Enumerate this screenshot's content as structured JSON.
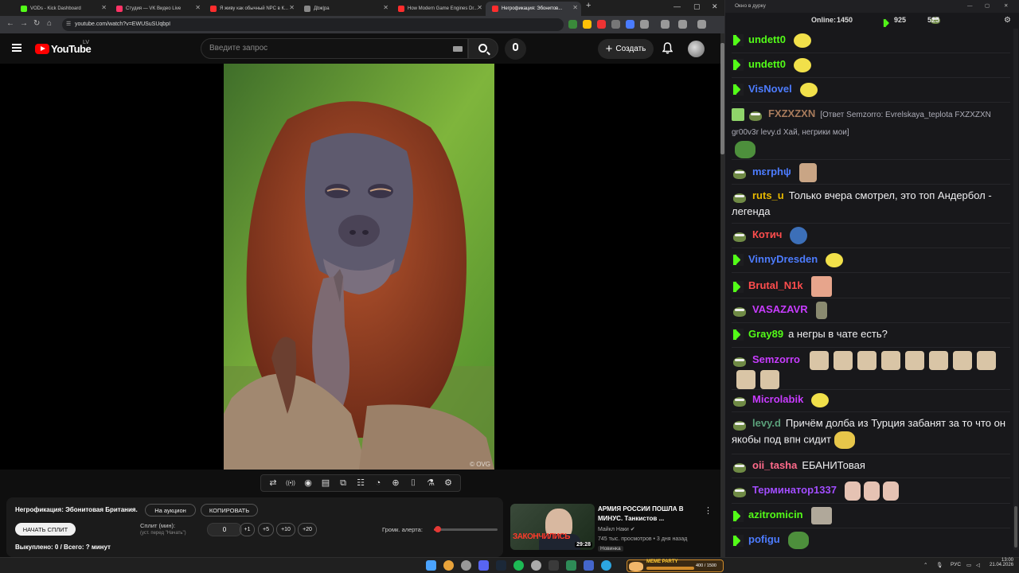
{
  "browser": {
    "tabs": [
      {
        "title": "VODs - Kick Dashboard",
        "color": "#53fc18"
      },
      {
        "title": "Студия — VK Видео Live",
        "color": "#ff3366"
      },
      {
        "title": "Я живу как обычный NPC в К...",
        "color": "#ff2d2d"
      },
      {
        "title": "Дbж|ра",
        "color": "#888888"
      },
      {
        "title": "How Modern Game Engines Dr...",
        "color": "#ff2d2d"
      },
      {
        "title": "Негрофикация: Эбонитов...",
        "color": "#ff2d2d"
      }
    ],
    "new_tab": "+",
    "url": "youtube.com/watch?v=EWUSuSUqbpI",
    "window_controls": [
      "—",
      "▢",
      "✕"
    ]
  },
  "youtube": {
    "logo": "YouTube",
    "region": "LV",
    "search_placeholder": "Введите запрос",
    "create_label": "Создать"
  },
  "player": {
    "watermark": "© OVG",
    "tool_icons": [
      "repeat-icon",
      "broadcast-icon",
      "camera-live-icon",
      "clapper-icon",
      "picture-in-picture-icon",
      "film-strip-icon",
      "speed-gauge-icon",
      "add-clip-icon",
      "screenshot-icon",
      "flask-icon",
      "settings-icon"
    ],
    "tool_glyphs": [
      "⇄",
      "((•))",
      "◉",
      "▤",
      "⧉",
      "☷",
      "◔",
      "⊕",
      "⌷",
      "⚗",
      "⚙"
    ]
  },
  "split_panel": {
    "title": "Негрофикация: Эбонитовая Британия.",
    "auction_label": "На аукцион",
    "copy_label": "КОПИРОВАТЬ",
    "start_label": "НАЧАТЬ СПЛИТ",
    "split_label": "Сплит (мин):",
    "split_hint": "(уст. перед \"Начать\")",
    "minutes_value": "0",
    "steppers": [
      "+1",
      "+5",
      "+10",
      "+20"
    ],
    "volume_label": "Громк. алерта:",
    "volume_level": 0.06,
    "bought": "Выкуплено: 0 / Всего: ? минут"
  },
  "recommendation": {
    "title": "АРМИЯ РОССИИ ПОШЛА В МИНУС. Танкистов ...",
    "thumb_caption": "ЗАКОНЧИЛИСЬ",
    "duration": "29:28",
    "channel": "Майкл Наки",
    "meta": "745 тыс. просмотров • 3 дня назад",
    "badge": "Новинка"
  },
  "chat": {
    "window_title": "Окно в дурку",
    "online_label": "Online:",
    "online_value": "1450",
    "kick_count": "925",
    "pepe_count": "525",
    "messages": [
      {
        "user": "undett0",
        "color": "#53fc18",
        "badge": "kick",
        "text": "",
        "emotes": [
          "yellow"
        ]
      },
      {
        "user": "undett0",
        "color": "#53fc18",
        "badge": "kick",
        "text": "",
        "emotes": [
          "yellow"
        ]
      },
      {
        "user": "VisNovel",
        "color": "#4d7cff",
        "badge": "kick",
        "text": "",
        "emotes": [
          "yellow"
        ]
      },
      {
        "user": "FXZXZXN",
        "color": "#a87b5c",
        "badge": "pencil-pepe",
        "text": "[Ответ Semzorro: Evrelskaya_teplota FXZXZXN gr00v3r levy.d Хай, негрики мои]",
        "emotes": [
          "frog"
        ]
      },
      {
        "user": "mɛrphψ",
        "color": "#4d7cff",
        "badge": "pepe",
        "text": "",
        "emotes": [
          "skin"
        ]
      },
      {
        "user": "ruts_u",
        "color": "#e6b800",
        "badge": "pepe",
        "text": "Только вчера смотрел, это топ Андербол - легенда",
        "emotes": []
      },
      {
        "user": "Котич",
        "color": "#ff4d4d",
        "badge": "pepe",
        "text": "",
        "emotes": [
          "blue"
        ]
      },
      {
        "user": "VinnyDresden",
        "color": "#4d7cff",
        "badge": "kick",
        "text": "",
        "emotes": [
          "yellow"
        ]
      },
      {
        "user": "Brutal_N1k",
        "color": "#ff4d4d",
        "badge": "kick",
        "text": "",
        "emotes": [
          "face"
        ]
      },
      {
        "user": "VASAZAVR",
        "color": "#c83cff",
        "badge": "pepe",
        "text": "",
        "emotes": [
          "guy"
        ]
      },
      {
        "user": "Gray89",
        "color": "#53fc18",
        "badge": "kick",
        "text": "а негры в чате есть?",
        "emotes": []
      },
      {
        "user": "Semzorro",
        "color": "#c83cff",
        "badge": "pepe",
        "text": "",
        "emotes": [
          "mini",
          "mini",
          "mini",
          "mini",
          "mini",
          "mini",
          "mini",
          "mini",
          "mini",
          "mini"
        ]
      },
      {
        "user": "Microlabik",
        "color": "#c83cff",
        "badge": "pepe",
        "text": "",
        "emotes": [
          "yellow"
        ]
      },
      {
        "user": "levy.d",
        "color": "#5aa07a",
        "badge": "pepe",
        "text": "Причём долба из Турция забанят за то что он якобы под впн сидит",
        "emotes": [
          "laugh"
        ]
      },
      {
        "user": "oii_tasha",
        "color": "#ff6a8a",
        "badge": "pepe",
        "text": "ЕБАНИТовая",
        "emotes": []
      },
      {
        "user": "Терминатор1337",
        "color": "#a24dff",
        "badge": "pepe",
        "text": "",
        "emotes": [
          "pink",
          "pink",
          "pink"
        ]
      },
      {
        "user": "azitromicin",
        "color": "#53fc18",
        "badge": "kick",
        "text": "",
        "emotes": [
          "gray"
        ]
      },
      {
        "user": "pofigu",
        "color": "#4d7cff",
        "badge": "kick",
        "text": "",
        "emotes": [
          "frog"
        ]
      }
    ]
  },
  "taskbar": {
    "meme_title": "MEME PARTY",
    "meme_value": "400 / 1500",
    "lang": "РУС",
    "time": "13:00",
    "date": "21.04.2026"
  }
}
